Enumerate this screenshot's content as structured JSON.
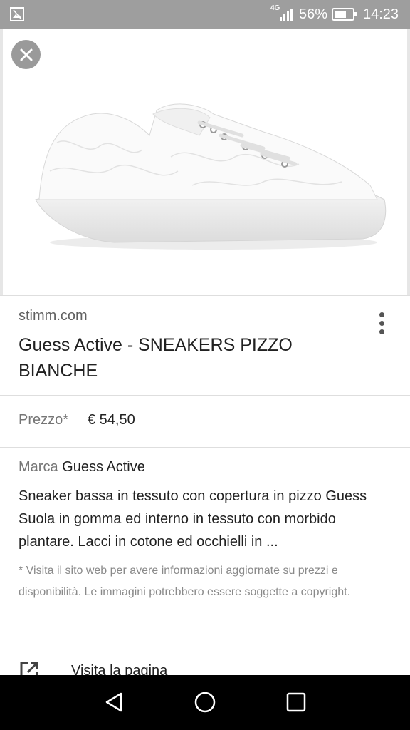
{
  "status_bar": {
    "network": "4G",
    "battery_percent": "56%",
    "time": "14:23"
  },
  "product": {
    "source": "stimm.com",
    "title": "Guess Active - SNEAKERS PIZZO BIANCHE",
    "price_label": "Prezzo*",
    "price_value": "€ 54,50",
    "brand_label": "Marca",
    "brand_value": "Guess Active",
    "description": "Sneaker bassa in tessuto con copertura in pizzo Guess Suola in gomma ed interno in tessuto con morbido plantare. Lacci in cotone ed occhielli in ...",
    "disclaimer": "* Visita il sito web per avere informazioni aggiornate su prezzi e disponibilità. Le immagini potrebbero essere soggette a copyright."
  },
  "actions": {
    "visit_page": "Visita la pagina"
  },
  "icons": {
    "close": "close-icon",
    "more": "more-vert-icon",
    "open_external": "open-in-new-icon",
    "back": "back-icon",
    "home": "home-icon",
    "recents": "recents-icon"
  },
  "colors": {
    "status_bar": "#9e9e9e",
    "nav_bar": "#000000",
    "close_button": "#9a9a9a"
  }
}
